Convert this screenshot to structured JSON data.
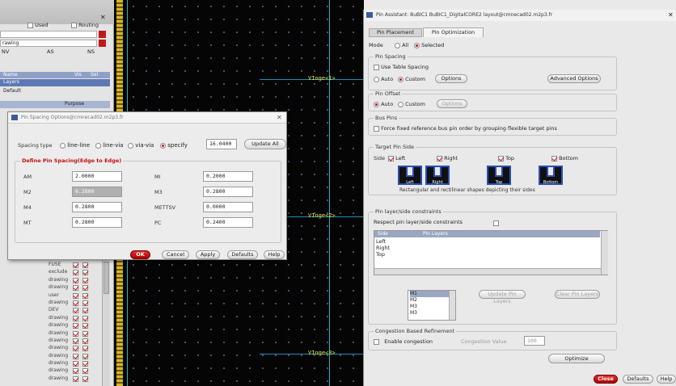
{
  "left_panel": {
    "tabs": [
      "Used",
      "Routing"
    ],
    "section_label": "rawing",
    "col_headers": [
      "NV",
      "AS",
      "NS"
    ],
    "table_headers": [
      "Name",
      "Vis",
      "Sel"
    ],
    "selected_row": "Layers",
    "row2": "Default",
    "row3_right": "Purpose",
    "layer_rows": [
      "FUSE",
      "exclude",
      "drawing",
      "drawing",
      "user",
      "drawing",
      "DEV",
      "drawing",
      "drawing",
      "drawing",
      "drawing",
      "drawing",
      "drawing",
      "drawing",
      "drawing",
      "drawing"
    ]
  },
  "canvas": {
    "pin_labels": [
      "VIoge<1>",
      "VIoge<2>",
      "VIoge<3>"
    ]
  },
  "spacing_dialog": {
    "title": "Pin Spacing Options@cmnecad02.m2p3.fr",
    "spacing_type_label": "Spacing type",
    "options": [
      "line-line",
      "line-via",
      "via-via",
      "specify"
    ],
    "selected_option": "specify",
    "specify_value": "16.0400",
    "update_all": "Update All",
    "group_title": "Define Pin Spacing(Edge to Edge)",
    "fields": [
      {
        "label": "AM",
        "value": "2.0000"
      },
      {
        "label": "MI",
        "value": "0.2000"
      },
      {
        "label": "M2",
        "value": "0.2800"
      },
      {
        "label": "M3",
        "value": "0.2800"
      },
      {
        "label": "M4",
        "value": "0.2800"
      },
      {
        "label": "METTSV",
        "value": "0.0000"
      },
      {
        "label": "MT",
        "value": "0.2800"
      },
      {
        "label": "PC",
        "value": "0.2400"
      }
    ],
    "buttons": {
      "ok": "OK",
      "cancel": "Cancel",
      "apply": "Apply",
      "defaults": "Defaults",
      "help": "Help"
    }
  },
  "pin_assistant": {
    "title": "Pin Assistant: BuBIC1 BuBIC1_DigitalCORE2 layout@cmnecad02.m2p3.fr",
    "tabs": [
      "Pin Placement",
      "Pin Optimization"
    ],
    "active_tab": "Pin Optimization",
    "mode_label": "Mode",
    "mode_options": [
      "All",
      "Selected"
    ],
    "mode_selected": "Selected",
    "pin_spacing": {
      "title": "Pin Spacing",
      "use_table": "Use Table Spacing",
      "auto": "Auto",
      "custom": "Custom",
      "options_btn": "Options",
      "advanced_btn": "Advanced Options"
    },
    "pin_offset": {
      "title": "Pin Offset",
      "auto": "Auto",
      "custom": "Custom",
      "options_btn": "Options"
    },
    "bus_pins": {
      "title": "Bus Pins",
      "text": "Force fixed reference bus pin order by grouping flexible target pins"
    },
    "target_side": {
      "title": "Target Pin Side",
      "side_label": "Side",
      "sides": [
        "Left",
        "Right",
        "Top",
        "Bottom"
      ],
      "caption": "Rectangular and rectilinear shapes depicting their sides",
      "shape_labels": [
        "Left",
        "Right",
        "Top",
        "Bottom"
      ]
    },
    "constraints": {
      "title": "Pin layer/side constraints",
      "respect": "Respect pin layer/side constraints",
      "headers": [
        "Side",
        "Pin Layers"
      ],
      "rows": [
        "Left",
        "Right",
        "Top"
      ],
      "layers": [
        "M1",
        "M2",
        "M3",
        "M3"
      ],
      "update_btn": "Update Pin Layers",
      "clear_btn": "Clear Pin Layers"
    },
    "congestion": {
      "title": "Congestion Based Refinement",
      "enable": "Enable congestion",
      "value_label": "Congestion Value",
      "value": "100",
      "optimize_btn": "Optimize"
    },
    "footer": {
      "close": "Close",
      "defaults": "Defaults",
      "help": "Help"
    }
  }
}
